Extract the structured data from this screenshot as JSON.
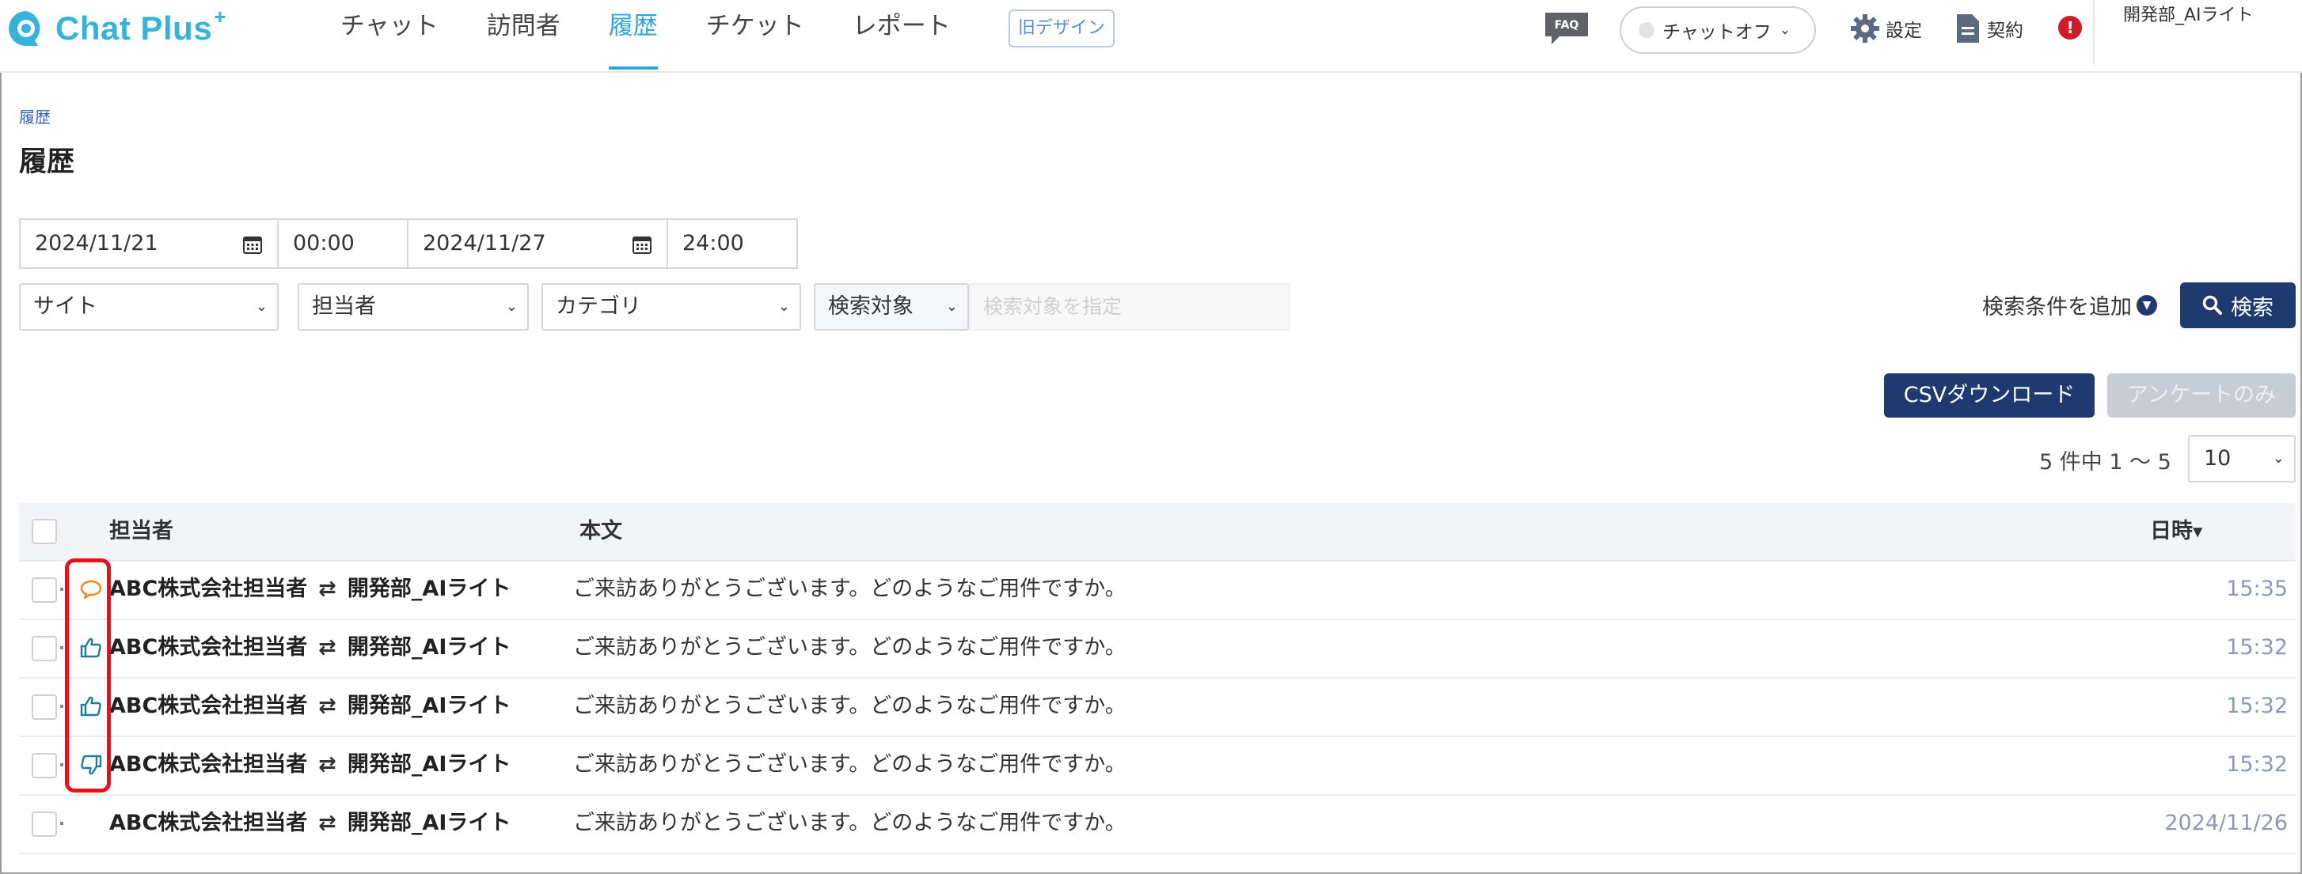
{
  "app": {
    "logo_text": "Chat Plus",
    "logo_sup": "+"
  },
  "nav": {
    "items": [
      {
        "label": "チャット",
        "active": false
      },
      {
        "label": "訪問者",
        "active": false
      },
      {
        "label": "履歴",
        "active": true
      },
      {
        "label": "チケット",
        "active": false
      },
      {
        "label": "レポート",
        "active": false
      }
    ],
    "old_design": "旧デザイン"
  },
  "header_right": {
    "faq": "FAQ",
    "chat_status": "チャットオフ",
    "settings": "設定",
    "contract": "契約",
    "alert": "!",
    "user_name": "開発部_AIライト"
  },
  "page": {
    "breadcrumb": "履歴",
    "title": "履歴"
  },
  "filters": {
    "date_from": "2024/11/21",
    "time_from": "00:00",
    "date_to": "2024/11/27",
    "time_to": "24:00",
    "site": "サイト",
    "agent": "担当者",
    "category": "カテゴリ",
    "search_target": "検索対象",
    "search_target_placeholder": "検索対象を指定",
    "add_condition": "検索条件を追加",
    "search_button": "検索"
  },
  "actions": {
    "csv": "CSVダウンロード",
    "survey_only": "アンケートのみ"
  },
  "pagination": {
    "summary": "5 件中 1 ～ 5",
    "per_page": "10"
  },
  "table": {
    "headers": {
      "agent": "担当者",
      "body": "本文",
      "datetime": "日時"
    },
    "rows": [
      {
        "icon": "speech-bubble-icon",
        "from": "ABC株式会社担当者",
        "arrow": "⇄",
        "to": "開発部_AIライト",
        "body": "ご来訪ありがとうございます。どのようなご用件ですか。",
        "time": "15:35"
      },
      {
        "icon": "thumbs-up-icon",
        "from": "ABC株式会社担当者",
        "arrow": "⇄",
        "to": "開発部_AIライト",
        "body": "ご来訪ありがとうございます。どのようなご用件ですか。",
        "time": "15:32"
      },
      {
        "icon": "thumbs-up-icon",
        "from": "ABC株式会社担当者",
        "arrow": "⇄",
        "to": "開発部_AIライト",
        "body": "ご来訪ありがとうございます。どのようなご用件ですか。",
        "time": "15:32"
      },
      {
        "icon": "thumbs-down-icon",
        "from": "ABC株式会社担当者",
        "arrow": "⇄",
        "to": "開発部_AIライト",
        "body": "ご来訪ありがとうございます。どのようなご用件ですか。",
        "time": "15:32"
      },
      {
        "icon": "",
        "from": "ABC株式会社担当者",
        "arrow": "⇄",
        "to": "開発部_AIライト",
        "body": "ご来訪ありがとうございます。どのようなご用件ですか。",
        "time": "2024/11/26"
      }
    ]
  },
  "colors": {
    "brand": "#36b3d8",
    "primary_button": "#1e3a6e",
    "highlight": "#e8101b",
    "icon_orange": "#f08a1c",
    "icon_teal": "#1b7e9a"
  }
}
